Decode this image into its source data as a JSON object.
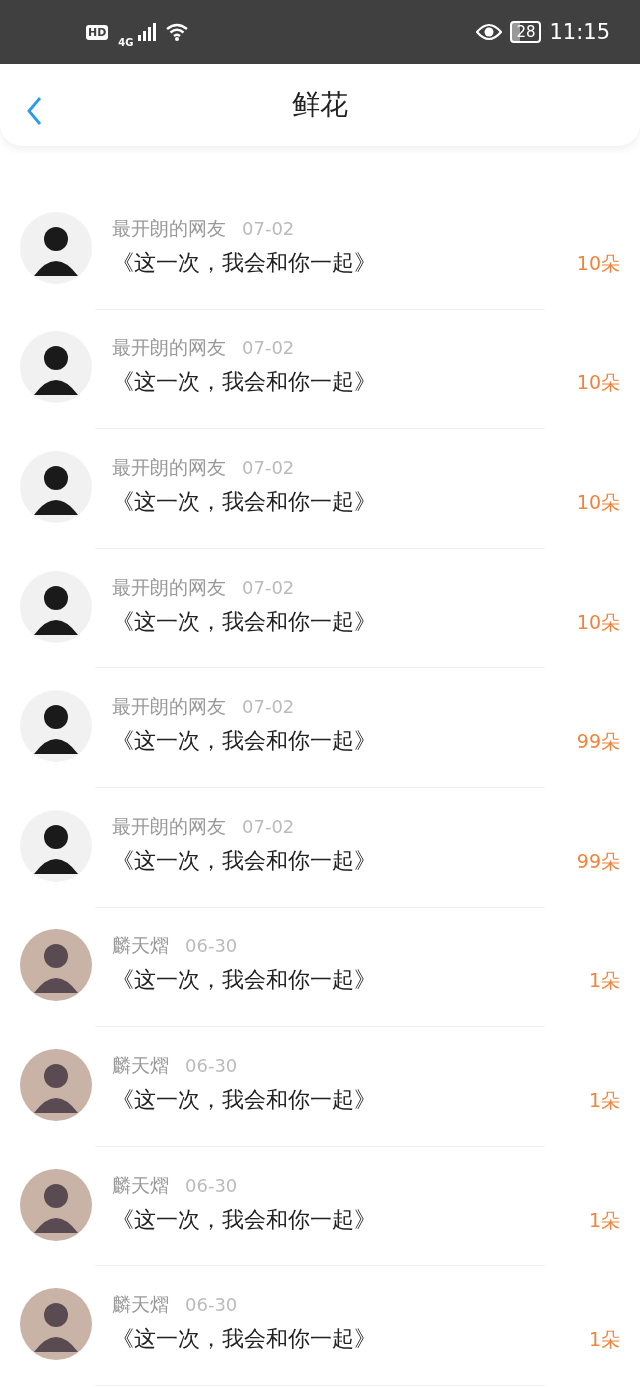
{
  "status_bar": {
    "hd": "HD",
    "network": "4G",
    "battery": "28",
    "time": "11:15"
  },
  "header": {
    "title": "鲜花"
  },
  "rows": [
    {
      "kind": "light",
      "name": "最开朗的网友",
      "date": "07-02",
      "title": "《这一次，我会和你一起》",
      "count": "10朵"
    },
    {
      "kind": "light",
      "name": "最开朗的网友",
      "date": "07-02",
      "title": "《这一次，我会和你一起》",
      "count": "10朵"
    },
    {
      "kind": "light",
      "name": "最开朗的网友",
      "date": "07-02",
      "title": "《这一次，我会和你一起》",
      "count": "10朵"
    },
    {
      "kind": "light",
      "name": "最开朗的网友",
      "date": "07-02",
      "title": "《这一次，我会和你一起》",
      "count": "10朵"
    },
    {
      "kind": "light",
      "name": "最开朗的网友",
      "date": "07-02",
      "title": "《这一次，我会和你一起》",
      "count": "99朵"
    },
    {
      "kind": "light",
      "name": "最开朗的网友",
      "date": "07-02",
      "title": "《这一次，我会和你一起》",
      "count": "99朵"
    },
    {
      "kind": "colored",
      "name": "麟天熠",
      "date": "06-30",
      "title": "《这一次，我会和你一起》",
      "count": "1朵"
    },
    {
      "kind": "colored",
      "name": "麟天熠",
      "date": "06-30",
      "title": "《这一次，我会和你一起》",
      "count": "1朵"
    },
    {
      "kind": "colored",
      "name": "麟天熠",
      "date": "06-30",
      "title": "《这一次，我会和你一起》",
      "count": "1朵"
    },
    {
      "kind": "colored",
      "name": "麟天熠",
      "date": "06-30",
      "title": "《这一次，我会和你一起》",
      "count": "1朵"
    }
  ]
}
